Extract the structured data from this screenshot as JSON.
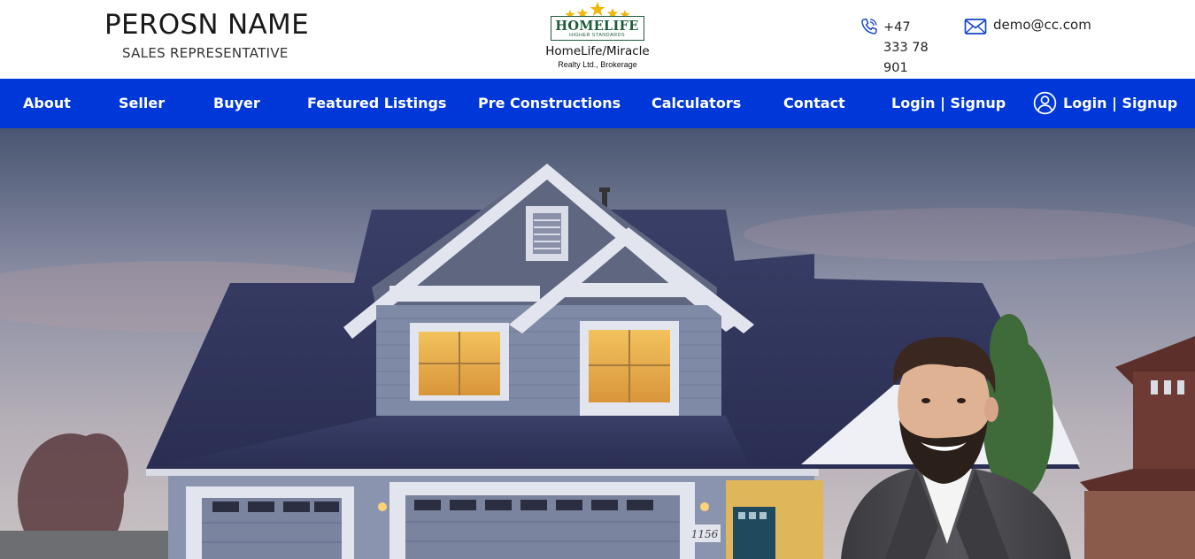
{
  "agent": {
    "name": "PEROSN NAME",
    "title": "SALES REPRESENTATIVE"
  },
  "logo": {
    "brand": "HOMELIFE",
    "slogan": "HIGHER STANDARDS",
    "company": "HomeLife/Miracle",
    "sub": "Realty Ltd., Brokerage"
  },
  "contact": {
    "phone": "+47 333 78 901",
    "email": "demo@cc.com"
  },
  "nav": {
    "items": [
      {
        "label": "About"
      },
      {
        "label": "Seller"
      },
      {
        "label": "Buyer"
      },
      {
        "label": "Featured Listings"
      },
      {
        "label": "Pre Constructions"
      },
      {
        "label": "Calculators"
      },
      {
        "label": "Contact"
      },
      {
        "label": "Login | Signup"
      }
    ],
    "account_label": "Login | Signup"
  },
  "hero": {
    "house_number": "1156"
  },
  "colors": {
    "nav_bg": "#0037d8",
    "logo_green": "#1f5a3a",
    "star_gold": "#f2b705"
  }
}
